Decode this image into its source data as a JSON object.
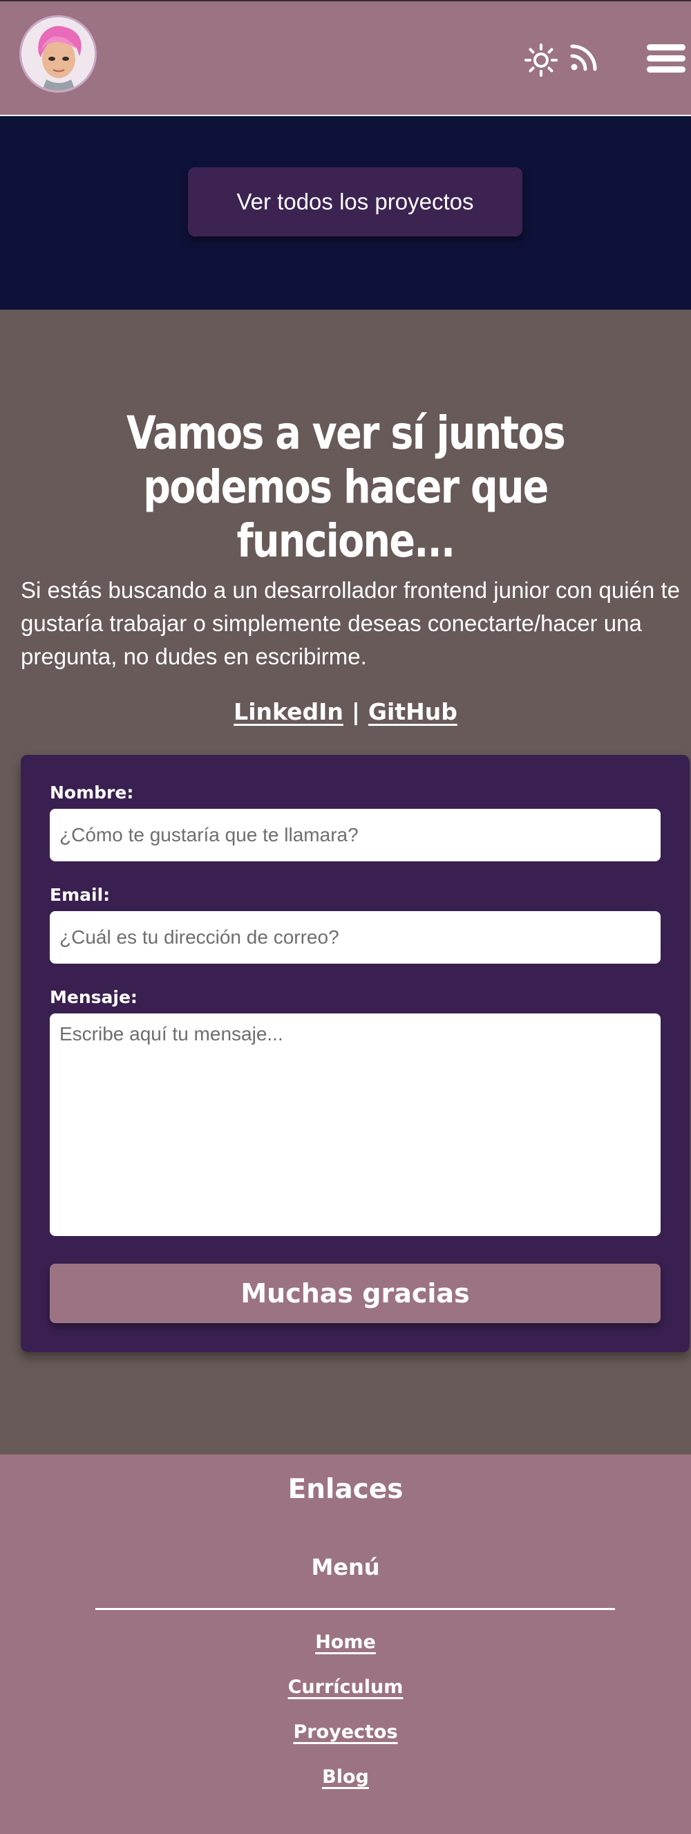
{
  "header": {
    "avatar_alt": "avatar",
    "icons": [
      "sun-icon",
      "rss-icon",
      "menu-icon"
    ]
  },
  "projects": {
    "button_label": "Ver todos los proyectos"
  },
  "contact": {
    "title_line1": "Vamos a ver sí juntos",
    "title_line2": "podemos hacer que funcione...",
    "text": "Si estás buscando a un desarrollador frontend junior con quién te gustaría trabajar o simplemente deseas conectarte/hacer una pregunta, no dudes en escribirme.",
    "links": {
      "linkedin": "LinkedIn",
      "separator": "|",
      "github": "GitHub"
    },
    "form": {
      "name_label": "Nombre:",
      "name_placeholder": "¿Cómo te gustaría que te llamara?",
      "email_label": "Email:",
      "email_placeholder": "¿Cuál es tu dirección de correo?",
      "message_label": "Mensaje:",
      "message_placeholder": "Escribe aquí tu mensaje...",
      "submit_label": "Muchas gracias"
    }
  },
  "footer": {
    "title": "Enlaces",
    "subtitle": "Menú",
    "links": [
      "Home",
      "Currículum",
      "Proyectos",
      "Blog"
    ]
  },
  "colors": {
    "header_bg": "#9c7382",
    "projects_bg": "#0f1238",
    "contact_bg": "#675a58",
    "form_bg": "#392050",
    "button_bg": "#3c2352"
  }
}
